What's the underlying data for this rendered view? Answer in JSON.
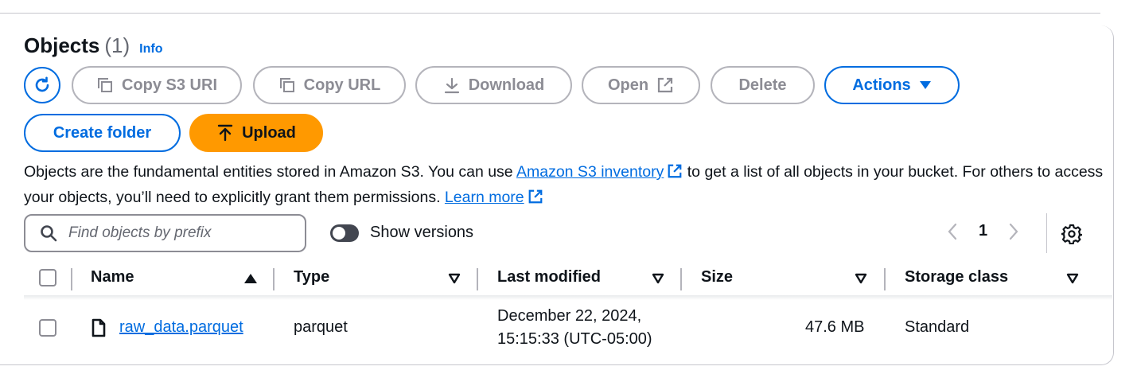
{
  "header": {
    "title": "Objects",
    "count": "(1)",
    "info": "Info"
  },
  "toolbar": {
    "copy_s3_uri": "Copy S3 URI",
    "copy_url": "Copy URL",
    "download": "Download",
    "open": "Open",
    "delete": "Delete",
    "actions": "Actions",
    "create_folder": "Create folder",
    "upload": "Upload"
  },
  "description": {
    "part1": "Objects are the fundamental entities stored in Amazon S3. You can use ",
    "link1": "Amazon S3 inventory",
    "part2": " to get a list of all objects in your bucket. For others to access your objects, you’ll need to explicitly grant them permissions. ",
    "link2": "Learn more"
  },
  "search": {
    "placeholder": "Find objects by prefix"
  },
  "versions_toggle": {
    "label": "Show versions",
    "on": false
  },
  "pagination": {
    "current_page": "1"
  },
  "table": {
    "columns": [
      "Name",
      "Type",
      "Last modified",
      "Size",
      "Storage class"
    ],
    "rows": [
      {
        "name": "raw_data.parquet",
        "type": "parquet",
        "last_modified_line1": "December 22, 2024,",
        "last_modified_line2": "15:15:33 (UTC-05:00)",
        "size": "47.6 MB",
        "storage_class": "Standard"
      }
    ]
  },
  "colors": {
    "link": "#006ce0",
    "upload": "#ff9900",
    "disabled": "#8c8c94"
  },
  "icons": [
    "refresh-icon",
    "copy-icon",
    "download-icon",
    "external-link-icon",
    "caret-down-icon",
    "upload-icon",
    "search-icon",
    "chevron-left-icon",
    "chevron-right-icon",
    "gear-icon",
    "sort-ascending-icon",
    "sort-descending-icon",
    "file-icon"
  ]
}
